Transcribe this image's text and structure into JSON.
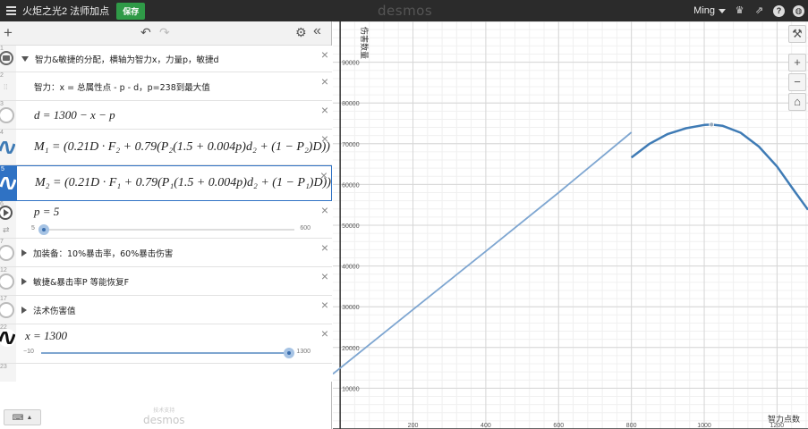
{
  "header": {
    "title": "火炬之光2 法师加点",
    "save_label": "保存",
    "brand": "desmos",
    "user": "Ming",
    "icons": [
      "menu-icon",
      "trophy-icon",
      "share-icon",
      "help-icon",
      "globe-icon"
    ]
  },
  "toolbar": {
    "add_label": "+",
    "undo_label": "↶",
    "redo_label": "↷",
    "settings_label": "⚙",
    "collapse_label": "«"
  },
  "expressions": [
    {
      "num": "1",
      "type": "folder",
      "text": "智力&敏捷的分配，横轴为智力x，力量p，敏捷d"
    },
    {
      "num": "2",
      "type": "note",
      "text": "智力：x = 总属性点 - p - d，p=238到最大值"
    },
    {
      "num": "3",
      "type": "expr",
      "latex": "d = 1300 − x − p"
    },
    {
      "num": "4",
      "type": "expr",
      "latex": "M₁ = (0.21D · F₂ + 0.79(P₂(1.5 + 0.004p)d₂ + (1 − P₂)D))"
    },
    {
      "num": "5",
      "type": "expr",
      "latex": "M₂ = (0.21D · F₁ + 0.79(P₁(1.5 + 0.004p)d₂ + (1 − P₁)D))"
    },
    {
      "num": "6",
      "type": "slider",
      "latex": "p = 5",
      "min": "5",
      "max": "600",
      "value": 5
    },
    {
      "num": "7",
      "type": "folder",
      "text": "加装备：10%暴击率，60%暴击伤害"
    },
    {
      "num": "12",
      "type": "folder",
      "text": "敏捷&暴击率P 等能恢复F"
    },
    {
      "num": "17",
      "type": "folder",
      "text": "法术伤害值"
    },
    {
      "num": "22",
      "type": "slider",
      "latex": "x = 1300",
      "min": "−10",
      "max": "1300",
      "value": 1300
    },
    {
      "num": "23",
      "type": "empty"
    }
  ],
  "footer": {
    "keyboard_label": "⌨",
    "powered_small": "技术支持",
    "powered_brand": "desmos"
  },
  "graph": {
    "y_axis_label": "伤害数量",
    "x_axis_label": "智力点数",
    "x_ticks": [
      "200",
      "400",
      "600",
      "800",
      "1000",
      "1200"
    ],
    "y_ticks": [
      "10000",
      "20000",
      "30000",
      "40000",
      "50000",
      "60000",
      "70000",
      "80000",
      "90000"
    ],
    "side_tools": [
      "wrench-icon",
      "zoom-in-icon",
      "zoom-out-icon",
      "home-icon"
    ]
  },
  "chart_data": {
    "type": "line",
    "xlabel": "智力点数",
    "ylabel": "伤害数量",
    "xlim": [
      -20,
      1285
    ],
    "ylim": [
      0,
      100000
    ],
    "grid": true,
    "series": [
      {
        "color": "#7ea6d1",
        "points": [
          [
            -20,
            13500
          ],
          [
            200,
            29300
          ],
          [
            400,
            43600
          ],
          [
            600,
            58000
          ],
          [
            800,
            72800
          ]
        ]
      },
      {
        "color": "#3f7bb5",
        "points": [
          [
            800,
            66600
          ],
          [
            850,
            70000
          ],
          [
            900,
            72400
          ],
          [
            950,
            73800
          ],
          [
            1000,
            74600
          ],
          [
            1020,
            74700
          ],
          [
            1050,
            74400
          ],
          [
            1100,
            72700
          ],
          [
            1150,
            69300
          ],
          [
            1200,
            64400
          ],
          [
            1250,
            58100
          ],
          [
            1285,
            53800
          ]
        ]
      }
    ],
    "marked_point": {
      "x": 1020,
      "y": 74700
    }
  }
}
